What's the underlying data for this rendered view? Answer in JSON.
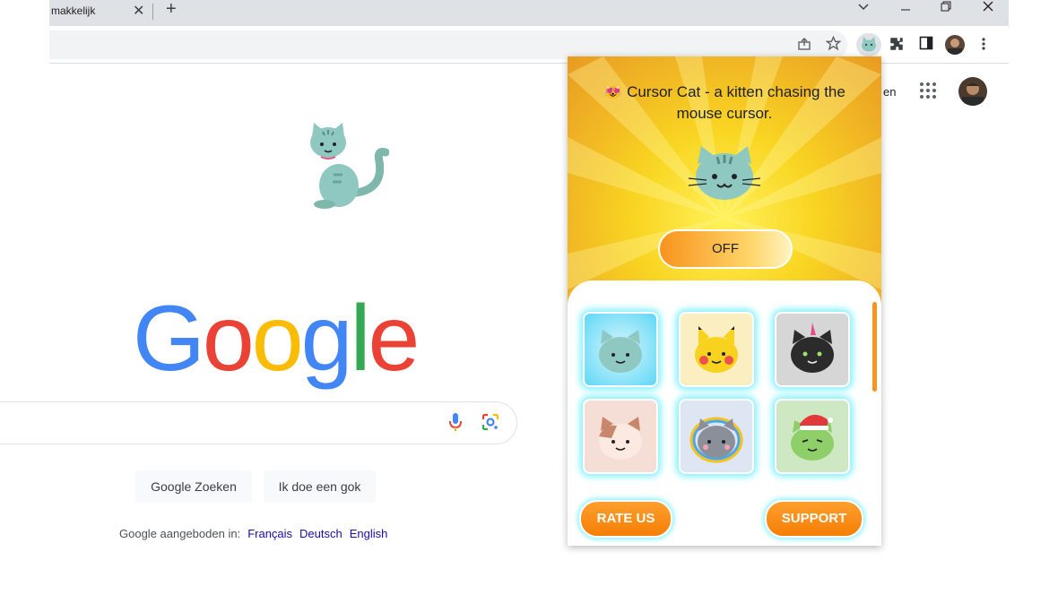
{
  "tab": {
    "title": "makkelijk",
    "close_glyph": "✕",
    "new_tab_glyph": "+"
  },
  "window_controls": {
    "tab_search": "⌄",
    "minimize": "—",
    "restore": "❐",
    "close": "✕"
  },
  "toolbar": {
    "icons": [
      "share-icon",
      "bookmark-star-icon",
      "cursor-cat-extension-icon",
      "extensions-puzzle-icon",
      "side-panel-icon",
      "profile-avatar",
      "menu-dots-icon"
    ]
  },
  "google": {
    "logo_letters": [
      {
        "char": "G",
        "color": "#4285f4"
      },
      {
        "char": "o",
        "color": "#ea4335"
      },
      {
        "char": "o",
        "color": "#fbbc05"
      },
      {
        "char": "g",
        "color": "#4285f4"
      },
      {
        "char": "l",
        "color": "#34a853"
      },
      {
        "char": "e",
        "color": "#ea4335"
      }
    ],
    "signin_partial": "en",
    "search_button": "Google Zoeken",
    "lucky_button": "Ik doe een gok",
    "offered_in": "Google aangeboden in:",
    "languages": [
      "Français",
      "Deutsch",
      "English"
    ]
  },
  "popup": {
    "title_emoji": "😻",
    "title": "Cursor Cat - a kitten chasing the mouse cursor.",
    "toggle_label": "OFF",
    "cats": [
      "tabby-cat",
      "pikachu-cat",
      "black-punk-cat",
      "calico-cat",
      "rainbow-gray-cat",
      "christmas-green-cat"
    ],
    "rate_label": "RATE US",
    "support_label": "SUPPORT",
    "accent": "#f7941d",
    "glow": "#7df0ff"
  }
}
